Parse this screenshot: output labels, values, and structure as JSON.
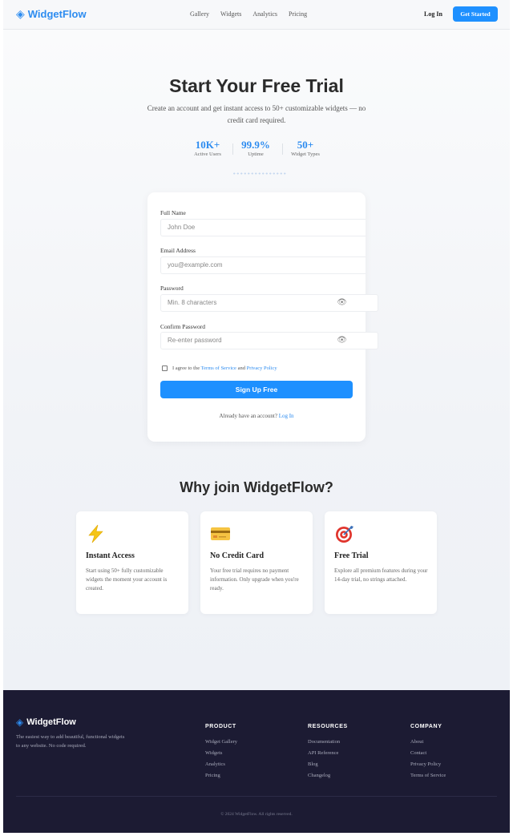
{
  "header": {
    "brand": "WidgetFlow",
    "nav": [
      "Gallery",
      "Widgets",
      "Analytics",
      "Pricing"
    ],
    "login": "Log In",
    "cta": "Get Started"
  },
  "hero": {
    "title": "Start Your Free Trial",
    "subtitle": "Create an account and get instant access to 50+ customizable widgets — no credit card required.",
    "stats": [
      {
        "value": "10K+",
        "label": "Active Users"
      },
      {
        "value": "99.9%",
        "label": "Uptime"
      },
      {
        "value": "50+",
        "label": "Widget Types"
      }
    ]
  },
  "form": {
    "full_name": {
      "label": "Full Name",
      "placeholder": "John Doe"
    },
    "email": {
      "label": "Email Address",
      "placeholder": "you@example.com"
    },
    "password": {
      "label": "Password",
      "placeholder": "Min. 8 characters"
    },
    "confirm": {
      "label": "Confirm Password",
      "placeholder": "Re-enter password"
    },
    "agree_prefix": "I agree to the",
    "terms": "Terms of Service",
    "and": "and",
    "privacy": "Privacy Policy",
    "submit": "Sign Up Free",
    "already": "Already have an account?",
    "login_link": "Log In"
  },
  "why": {
    "title": "Why join WidgetFlow?",
    "features": [
      {
        "icon": "lightning-icon",
        "title": "Instant Access",
        "desc": "Start using 50+ fully customizable widgets the moment your account is created."
      },
      {
        "icon": "credit-card-icon",
        "title": "No Credit Card",
        "desc": "Your free trial requires no payment information. Only upgrade when you're ready."
      },
      {
        "icon": "target-icon",
        "title": "Free Trial",
        "desc": "Explore all premium features during your 14-day trial, no strings attached."
      }
    ]
  },
  "footer": {
    "brand": "WidgetFlow",
    "tagline": "The easiest way to add beautiful, functional widgets to any website. No code required.",
    "columns": [
      {
        "title": "PRODUCT",
        "items": [
          "Widget Gallery",
          "Widgets",
          "Analytics",
          "Pricing"
        ]
      },
      {
        "title": "RESOURCES",
        "items": [
          "Documentation",
          "API Reference",
          "Blog",
          "Changelog"
        ]
      },
      {
        "title": "COMPANY",
        "items": [
          "About",
          "Contact",
          "Privacy Policy",
          "Terms of Service"
        ]
      }
    ],
    "copyright": "© 2024 WidgetFlow. All rights reserved."
  },
  "colors": {
    "accent": "#1e90ff",
    "footer_bg": "#1c1b33"
  }
}
